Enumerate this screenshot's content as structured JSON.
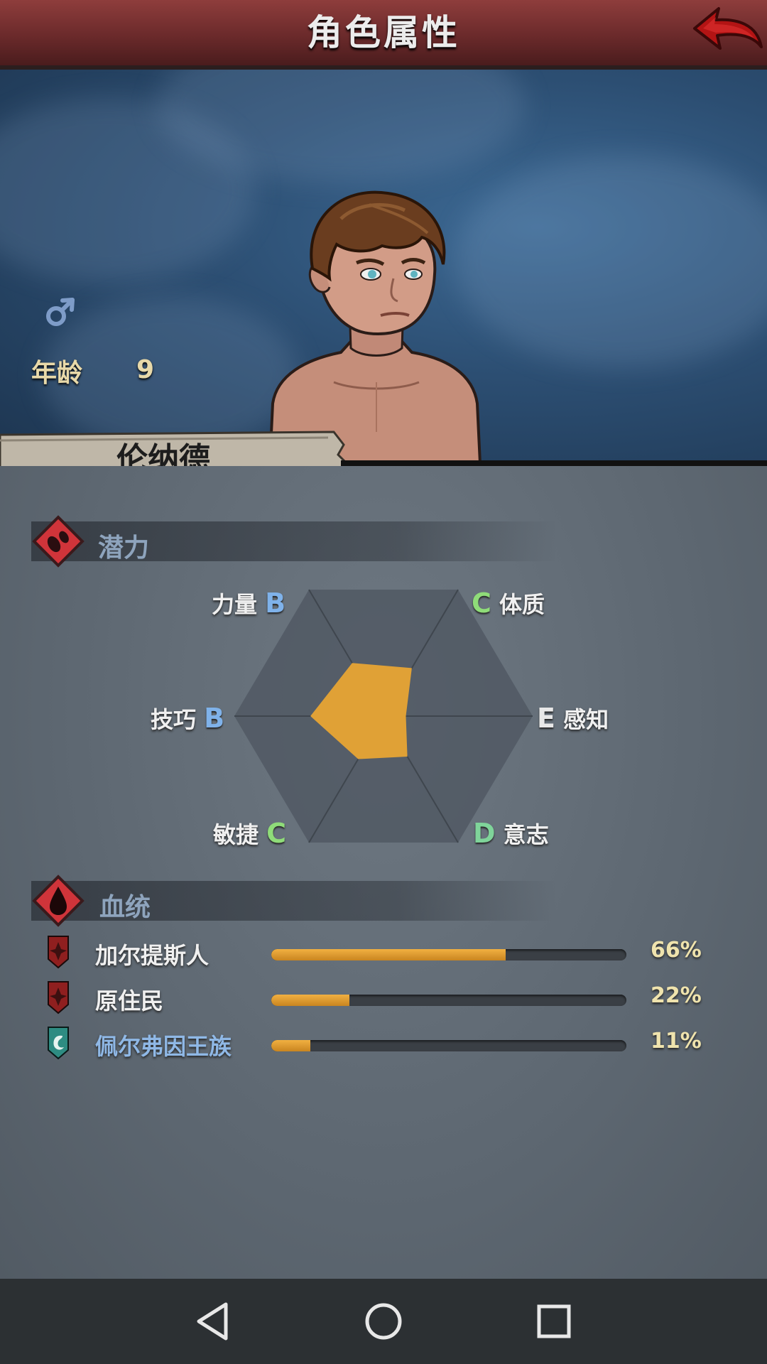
{
  "header": {
    "title": "角色属性"
  },
  "character": {
    "gender_symbol": "♂",
    "age_label": "年龄",
    "age_value": "9",
    "name": "伦纳德"
  },
  "potential": {
    "section_title": "潜力",
    "stats": [
      {
        "key": "strength",
        "label": "力量",
        "grade": "B",
        "value": 0.42
      },
      {
        "key": "constitution",
        "label": "体质",
        "grade": "C",
        "value": 0.38
      },
      {
        "key": "perception",
        "label": "感知",
        "grade": "E",
        "value": 0.15
      },
      {
        "key": "will",
        "label": "意志",
        "grade": "D",
        "value": 0.32
      },
      {
        "key": "agility",
        "label": "敏捷",
        "grade": "C",
        "value": 0.34
      },
      {
        "key": "skill",
        "label": "技巧",
        "grade": "B",
        "value": 0.49
      }
    ]
  },
  "bloodline": {
    "section_title": "血统",
    "items": [
      {
        "name": "加尔提斯人",
        "percent_text": "66%",
        "value": 0.66,
        "emblem_color": "#8f1f1f",
        "name_color": "#f0f0f0"
      },
      {
        "name": "原住民",
        "percent_text": "22%",
        "value": 0.22,
        "emblem_color": "#8f1f1f",
        "name_color": "#f0f0f0"
      },
      {
        "name": "佩尔弗因王族",
        "percent_text": "11%",
        "value": 0.11,
        "emblem_color": "#2e8c82",
        "name_color": "#8fb8e6"
      }
    ]
  },
  "colors": {
    "accent_orange": "#e0a136",
    "header_red": "#7a3030"
  },
  "nav": {
    "icons": [
      "back-triangle-icon",
      "home-circle-icon",
      "recents-square-icon"
    ]
  }
}
